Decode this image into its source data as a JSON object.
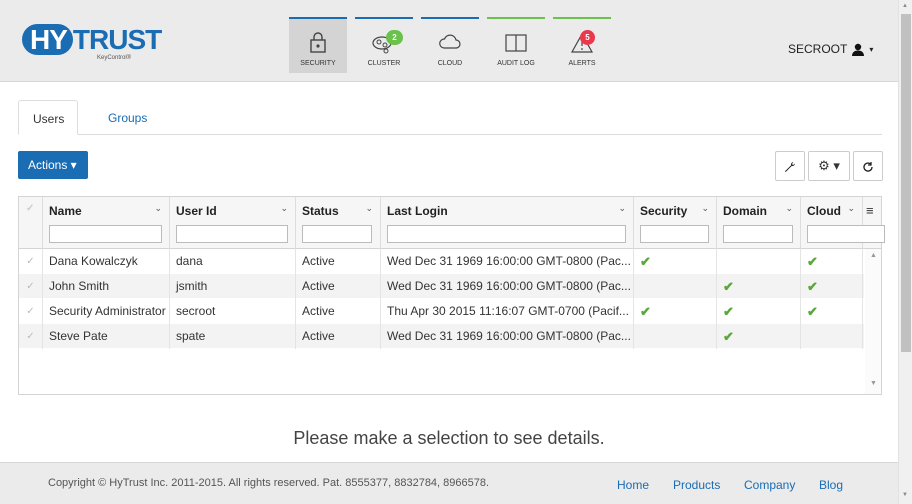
{
  "brand": {
    "logo_hy": "HY",
    "logo_trust": "TRUST",
    "logo_sub": "KeyControl®"
  },
  "nav": [
    {
      "label": "SECURITY",
      "color": "blue",
      "active": true,
      "icon": "lock-icon"
    },
    {
      "label": "CLUSTER",
      "color": "blue",
      "active": false,
      "icon": "cluster-icon",
      "badge": "2"
    },
    {
      "label": "CLOUD",
      "color": "blue",
      "active": false,
      "icon": "cloud-icon"
    },
    {
      "label": "AUDIT LOG",
      "color": "green",
      "active": false,
      "icon": "book-icon"
    },
    {
      "label": "ALERTS",
      "color": "green",
      "active": false,
      "icon": "warning-icon",
      "badge": "5"
    }
  ],
  "user_menu": {
    "name": "SECROOT",
    "icon": "user-icon"
  },
  "tabs": [
    {
      "label": "Users",
      "active": true
    },
    {
      "label": "Groups",
      "active": false
    }
  ],
  "toolbar": {
    "actions_label": "Actions ▾",
    "wrench_icon": "wrench-icon",
    "gear_label": "⚙ ▾",
    "refresh_icon": "refresh-icon"
  },
  "grid": {
    "columns": [
      "Name",
      "User Id",
      "Status",
      "Last Login",
      "Security",
      "Domain",
      "Cloud"
    ],
    "rows": [
      {
        "name": "Dana Kowalczyk",
        "user_id": "dana",
        "status": "Active",
        "last_login": "Wed Dec 31 1969 16:00:00 GMT-0800 (Pac...",
        "security": true,
        "domain": false,
        "cloud": true
      },
      {
        "name": "John Smith",
        "user_id": "jsmith",
        "status": "Active",
        "last_login": "Wed Dec 31 1969 16:00:00 GMT-0800 (Pac...",
        "security": false,
        "domain": true,
        "cloud": true
      },
      {
        "name": "Security Administrator",
        "user_id": "secroot",
        "status": "Active",
        "last_login": "Thu Apr 30 2015 11:16:07 GMT-0700 (Pacif...",
        "security": true,
        "domain": true,
        "cloud": true
      },
      {
        "name": "Steve Pate",
        "user_id": "spate",
        "status": "Active",
        "last_login": "Wed Dec 31 1969 16:00:00 GMT-0800 (Pac...",
        "security": false,
        "domain": true,
        "cloud": false
      }
    ]
  },
  "empty_message": "Please make a selection to see details.",
  "footer": {
    "copyright": "Copyright © HyTrust Inc. 2011-2015. All rights reserved. Pat. 8555377, 8832784, 8966578.",
    "links": [
      "Home",
      "Products",
      "Company",
      "Blog"
    ]
  },
  "colors": {
    "accent": "#1a6cb3",
    "green": "#6ac14b",
    "alert": "#e8394d",
    "check": "#5aa83a"
  }
}
